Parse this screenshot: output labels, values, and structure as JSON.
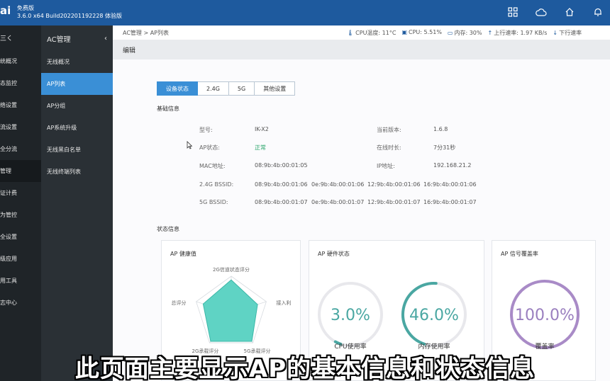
{
  "header": {
    "logo_text": "ai",
    "edition": "免费版",
    "build": "3.6.0 x64 Build202201192228 体验版",
    "icons": [
      "grid-icon",
      "cloud-icon",
      "home-icon",
      "bell-icon"
    ]
  },
  "nav_primary": {
    "head": "三く",
    "items": [
      {
        "label": "统概况",
        "active": false
      },
      {
        "label": "态监控",
        "active": false
      },
      {
        "label": "络设置",
        "active": false
      },
      {
        "label": "流设置",
        "active": false
      },
      {
        "label": "全分流",
        "active": false
      },
      {
        "label": "管理",
        "active": true
      },
      {
        "label": "证计费",
        "active": false
      },
      {
        "label": "为管控",
        "active": false
      },
      {
        "label": "全设置",
        "active": false
      },
      {
        "label": "级应用",
        "active": false
      },
      {
        "label": "用工具",
        "active": false
      },
      {
        "label": "志中心",
        "active": false
      }
    ]
  },
  "nav_secondary": {
    "title": "AC管理",
    "collapse": "‹",
    "items": [
      {
        "label": "无线概况",
        "active": false
      },
      {
        "label": "AP列表",
        "active": true
      },
      {
        "label": "AP分组",
        "active": false
      },
      {
        "label": "AP系统升级",
        "active": false
      },
      {
        "label": "无线黑白名单",
        "active": false
      },
      {
        "label": "无线终端列表",
        "active": false
      }
    ]
  },
  "statusbar": {
    "breadcrumb": "AC管理 > AP列表",
    "cpu_temp": "CPU温度: 11°C",
    "cpu": "CPU: 5.51%",
    "memory": "内存: 30%",
    "upload": "上行速率: 1.97 KB/s",
    "download": "下行速率"
  },
  "edit_title": "编辑",
  "tabs": [
    "设备状态",
    "2.4G",
    "5G",
    "其他设置"
  ],
  "basic_info": {
    "title": "基础信息",
    "model_label": "型号:",
    "model": "IK-X2",
    "version_label": "当前版本:",
    "version": "1.6.8",
    "status_label": "AP状态:",
    "status": "正常",
    "uptime_label": "在线时长:",
    "uptime": "7分31秒",
    "mac_label": "MAC地址:",
    "mac": "08:9b:4b:00:01:05",
    "ip_label": "IP地址:",
    "ip": "192.168.21.2",
    "bssid24_label": "2.4G BSSID:",
    "bssid24": [
      "08:9b:4b:00:01:06",
      "0e:9b:4b:00:01:06",
      "12:9b:4b:00:01:06",
      "16:9b:4b:00:01:06"
    ],
    "bssid5_label": "5G BSSID:",
    "bssid5": [
      "08:9b:4b:00:01:07",
      "0e:9b:4b:00:01:07",
      "12:9b:4b:00:01:07",
      "16:9b:4b:00:01:07"
    ]
  },
  "status_info": {
    "title": "状态信息",
    "health": {
      "title": "AP 健康值",
      "axes": [
        "2G信道状态评分",
        "接入利",
        "5G承载评分",
        "2G承载评分",
        "总评分"
      ],
      "values": [
        0.9,
        0.75,
        0.95,
        0.95,
        0.8
      ],
      "fill_color": "#5fd3c4"
    },
    "hardware": {
      "title": "AP 硬件状态",
      "cpu_value": "3.0%",
      "cpu_label": "CPU使用率",
      "cpu_fraction": 0.03,
      "mem_value": "46.0%",
      "mem_label": "内存使用率",
      "mem_fraction": 0.46,
      "color": "#4aa7a2"
    },
    "coverage": {
      "title": "AP 信号覆盖率",
      "value": "100.0%",
      "label": "覆盖率",
      "fraction": 1.0,
      "color": "#a98bc7"
    }
  },
  "caption": "此页面主要显示AP的基本信息和状态信息"
}
